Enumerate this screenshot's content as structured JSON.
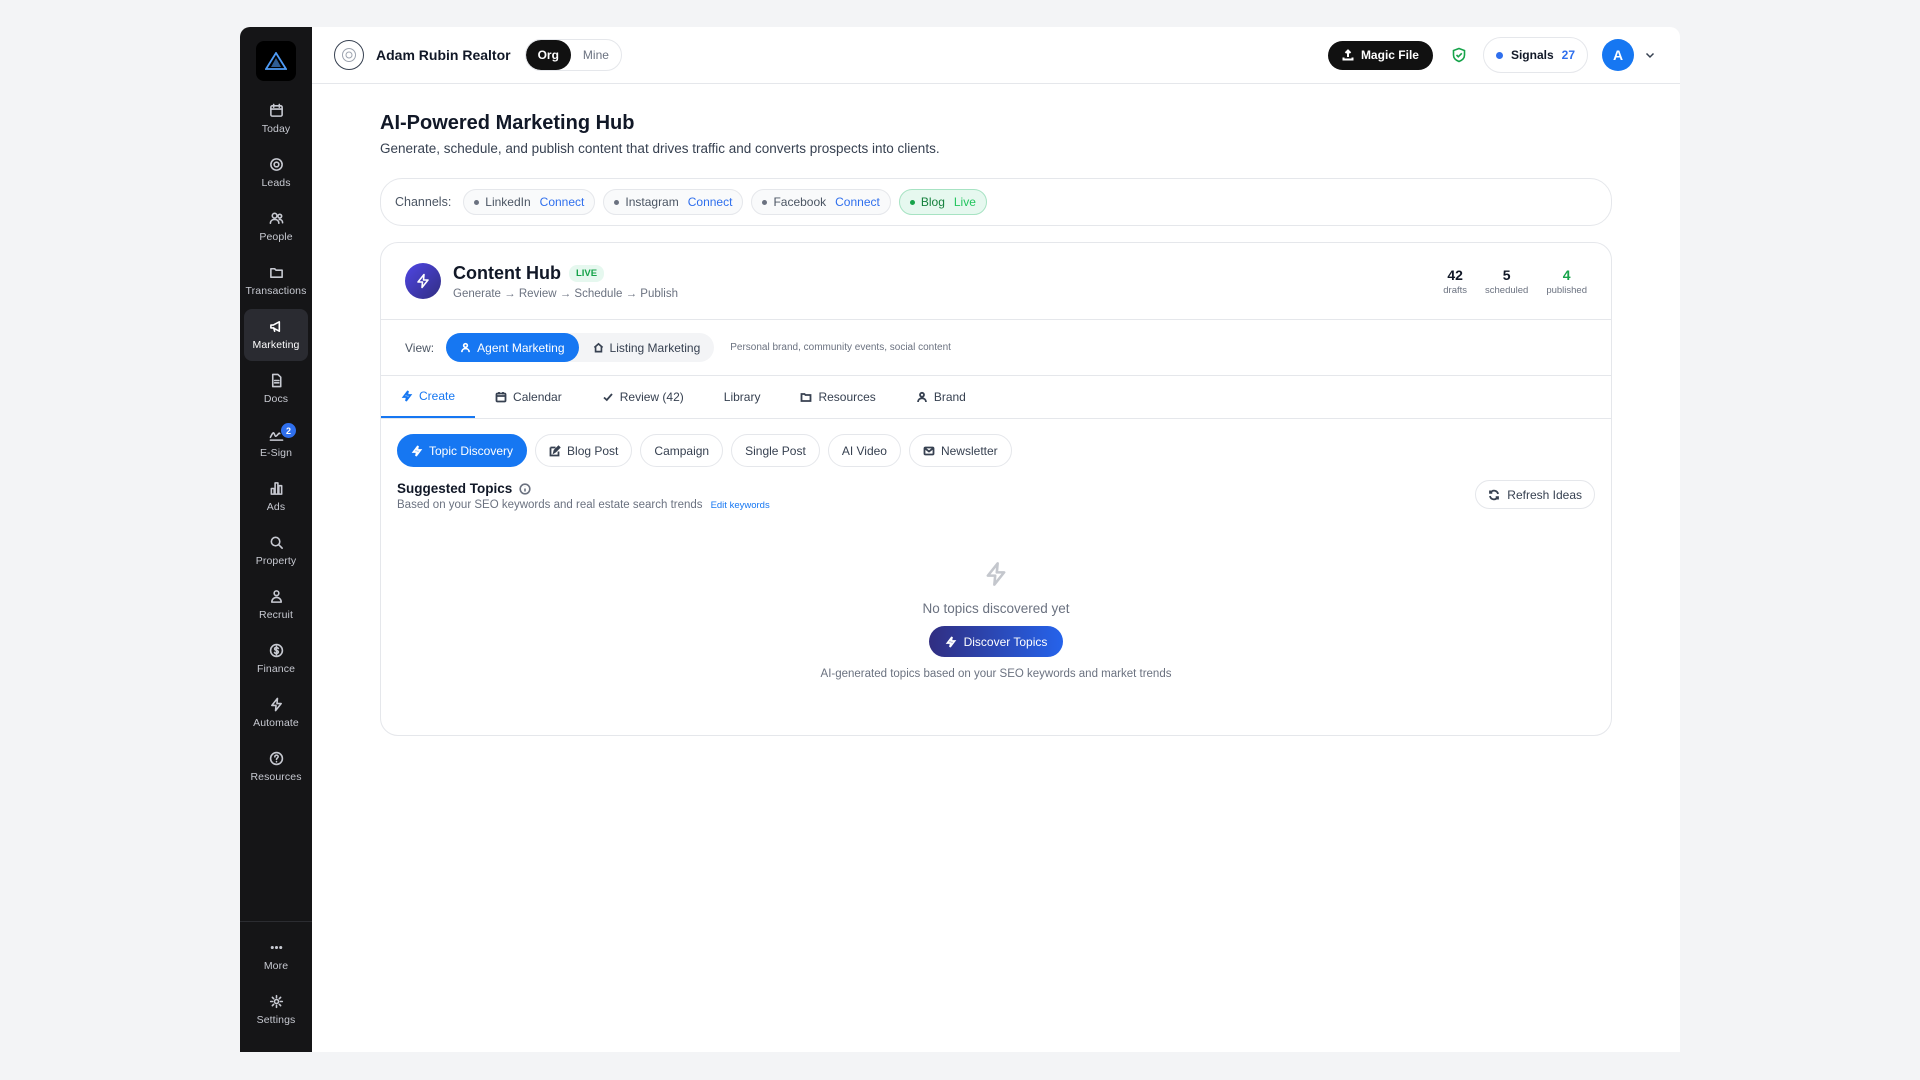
{
  "sidebar": {
    "items": [
      {
        "label": "Today",
        "icon": "calendar-icon"
      },
      {
        "label": "Leads",
        "icon": "target-icon"
      },
      {
        "label": "People",
        "icon": "users-icon"
      },
      {
        "label": "Transactions",
        "icon": "folder-icon"
      },
      {
        "label": "Marketing",
        "icon": "megaphone-icon"
      },
      {
        "label": "Docs",
        "icon": "document-icon"
      },
      {
        "label": "E-Sign",
        "icon": "signature-icon",
        "badge": "2"
      },
      {
        "label": "Ads",
        "icon": "bar-chart-icon"
      },
      {
        "label": "Property",
        "icon": "search-icon"
      },
      {
        "label": "Recruit",
        "icon": "recruit-icon"
      },
      {
        "label": "Finance",
        "icon": "dollar-icon"
      },
      {
        "label": "Automate",
        "icon": "bolt-icon"
      },
      {
        "label": "Resources",
        "icon": "help-icon"
      }
    ],
    "more_label": "More",
    "settings_label": "Settings"
  },
  "header": {
    "org_name": "Adam Rubin Realtor",
    "scope_org": "Org",
    "scope_mine": "Mine",
    "magic_file": "Magic File",
    "signals_label": "Signals",
    "signals_count": "27",
    "user_initial": "A"
  },
  "page": {
    "title": "AI-Powered Marketing Hub",
    "subtitle": "Generate, schedule, and publish content that drives traffic and converts prospects into clients."
  },
  "channels": {
    "label": "Channels:",
    "items": [
      {
        "name": "LinkedIn",
        "action": "Connect"
      },
      {
        "name": "Instagram",
        "action": "Connect"
      },
      {
        "name": "Facebook",
        "action": "Connect"
      },
      {
        "name": "Blog",
        "action": "Live"
      }
    ]
  },
  "hub": {
    "title": "Content Hub",
    "badge": "LIVE",
    "subtitle": "Generate → Review → Schedule → Publish",
    "stats": [
      {
        "value": "42",
        "label": "drafts"
      },
      {
        "value": "5",
        "label": "scheduled"
      },
      {
        "value": "4",
        "label": "published"
      }
    ],
    "view_label": "View:",
    "view_agent": "Agent Marketing",
    "view_listing": "Listing Marketing",
    "view_note": "Personal brand, community events, social content",
    "tabs": [
      "Create",
      "Calendar",
      "Review (42)",
      "Library",
      "Resources",
      "Brand"
    ],
    "types": [
      "Topic Discovery",
      "Blog Post",
      "Campaign",
      "Single Post",
      "AI Video",
      "Newsletter"
    ],
    "suggested_title": "Suggested Topics",
    "suggested_sub": "Based on your SEO keywords and real estate search trends",
    "edit_keywords": "Edit keywords",
    "refresh": "Refresh Ideas",
    "empty_text": "No topics discovered yet",
    "discover_button": "Discover Topics",
    "empty_note": "AI-generated topics based on your SEO keywords and market trends"
  },
  "colors": {
    "accent": "#1677f2",
    "sidebar": "#151517",
    "live_green": "#16a34a"
  }
}
